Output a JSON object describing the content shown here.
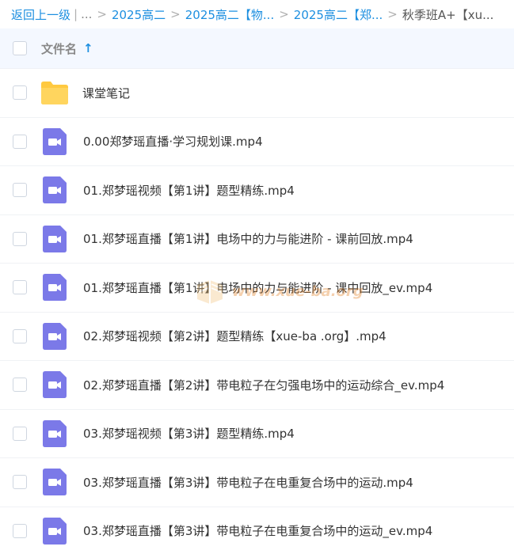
{
  "breadcrumb": {
    "back": "返回上一级",
    "bar": "|",
    "dots": "...",
    "sep": ">",
    "items": [
      "2025高二",
      "2025高二【物...",
      "2025高二【郑..."
    ],
    "current": "秋季班A+【xu..."
  },
  "header": {
    "column_label": "文件名",
    "sort_icon": "↑"
  },
  "files": [
    {
      "name": "课堂笔记",
      "type": "folder"
    },
    {
      "name": "0.00郑梦瑶直播·学习规划课.mp4",
      "type": "video"
    },
    {
      "name": "01.郑梦瑶视频【第1讲】题型精练.mp4",
      "type": "video"
    },
    {
      "name": "01.郑梦瑶直播【第1讲】电场中的力与能进阶 - 课前回放.mp4",
      "type": "video"
    },
    {
      "name": "01.郑梦瑶直播【第1讲】电场中的力与能进阶 - 课中回放_ev.mp4",
      "type": "video"
    },
    {
      "name": "02.郑梦瑶视频【第2讲】题型精练【xue-ba .org】.mp4",
      "type": "video"
    },
    {
      "name": "02.郑梦瑶直播【第2讲】带电粒子在匀强电场中的运动综合_ev.mp4",
      "type": "video"
    },
    {
      "name": "03.郑梦瑶视频【第3讲】题型精练.mp4",
      "type": "video"
    },
    {
      "name": "03.郑梦瑶直播【第3讲】带电粒子在电重复合场中的运动.mp4",
      "type": "video"
    },
    {
      "name": "03.郑梦瑶直播【第3讲】带电粒子在电重复合场中的运动_ev.mp4",
      "type": "video"
    }
  ],
  "watermark": {
    "text": "www.xue-ba.org"
  },
  "colors": {
    "accent": "#1d8fe0",
    "video_icon": "#7b79e8",
    "folder_icon": "#ffc940"
  }
}
